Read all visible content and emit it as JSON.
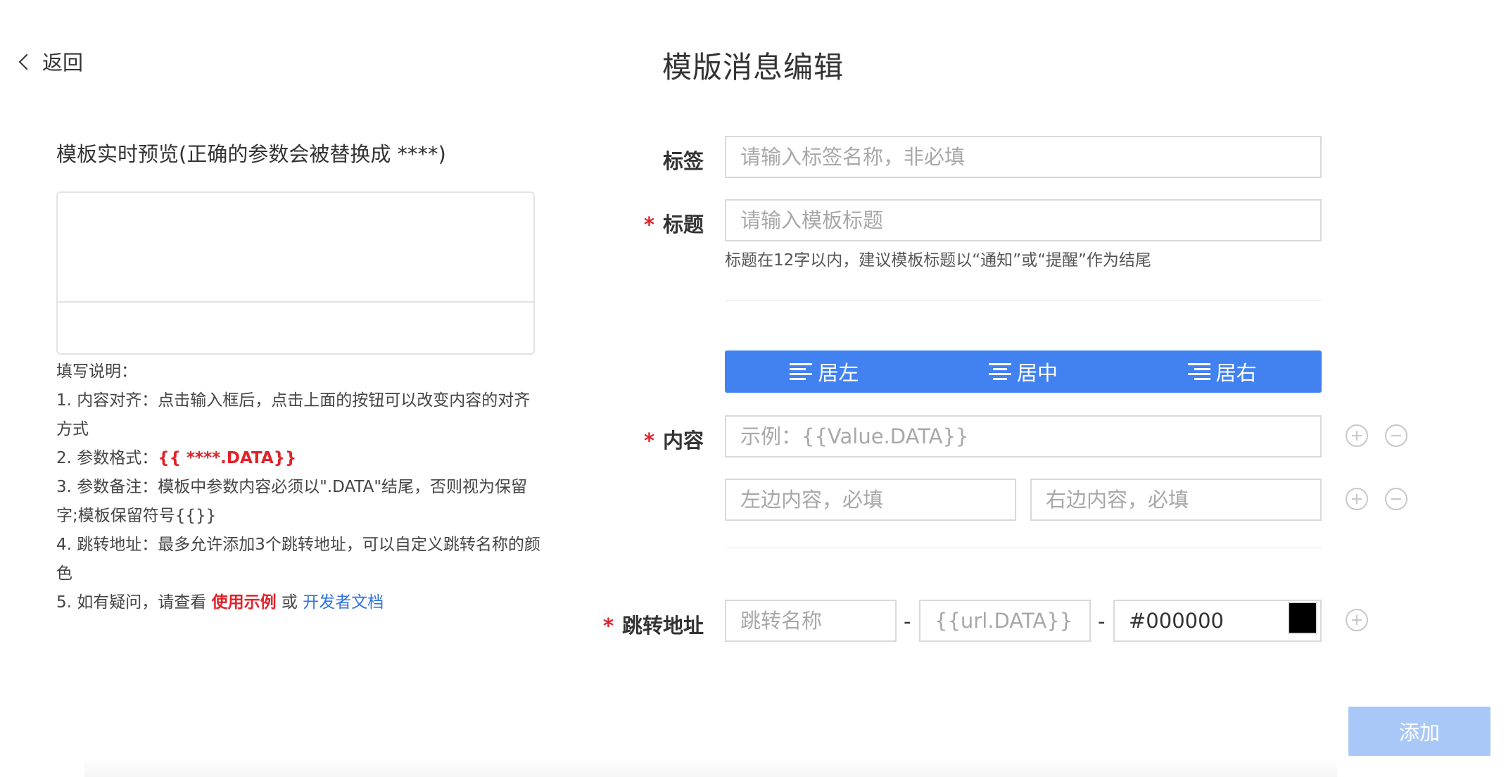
{
  "header": {
    "back_label": "返回",
    "title": "模版消息编辑"
  },
  "preview": {
    "title": "模板实时预览(正确的参数会被替换成 ****)"
  },
  "instructions": {
    "heading": "填写说明：",
    "item1": "1. 内容对齐：点击输入框后，点击上面的按钮可以改变内容的对齐方式",
    "item2_prefix": "2. 参数格式：",
    "item2_code": "{{ ****.DATA}}",
    "item3": "3. 参数备注：模板中参数内容必须以\".DATA\"结尾，否则视为保留字;模板保留符号{{}}",
    "item4": "4. 跳转地址：最多允许添加3个跳转地址，可以自定义跳转名称的颜色",
    "item5_prefix": "5. 如有疑问，请查看 ",
    "item5_link1": "使用示例",
    "item5_mid": " 或 ",
    "item5_link2": "开发者文档"
  },
  "form": {
    "tag_label": "标签",
    "tag_placeholder": "请输入标签名称，非必填",
    "required_mark": "*",
    "title_label": "标题",
    "title_placeholder": "请输入模板标题",
    "title_hint": "标题在12字以内，建议模板标题以“通知”或“提醒”作为结尾",
    "align": {
      "left": "居左",
      "center": "居中",
      "right": "居右"
    },
    "content_label": "内容",
    "content_placeholder": "示例：{{Value.DATA}}",
    "left_content_placeholder": "左边内容，必填",
    "right_content_placeholder": "右边内容，必填",
    "jump_label": "跳转地址",
    "jump_name_placeholder": "跳转名称",
    "jump_url_placeholder": "{{url.DATA}}",
    "jump_color_value": "#000000",
    "dash": "-"
  },
  "submit_label": "添加",
  "colors": {
    "accent": "#4282f0",
    "submit_disabled": "#a9c8f7",
    "required": "#e0222a",
    "link": "#2f73e4",
    "swatch": "#000000"
  }
}
